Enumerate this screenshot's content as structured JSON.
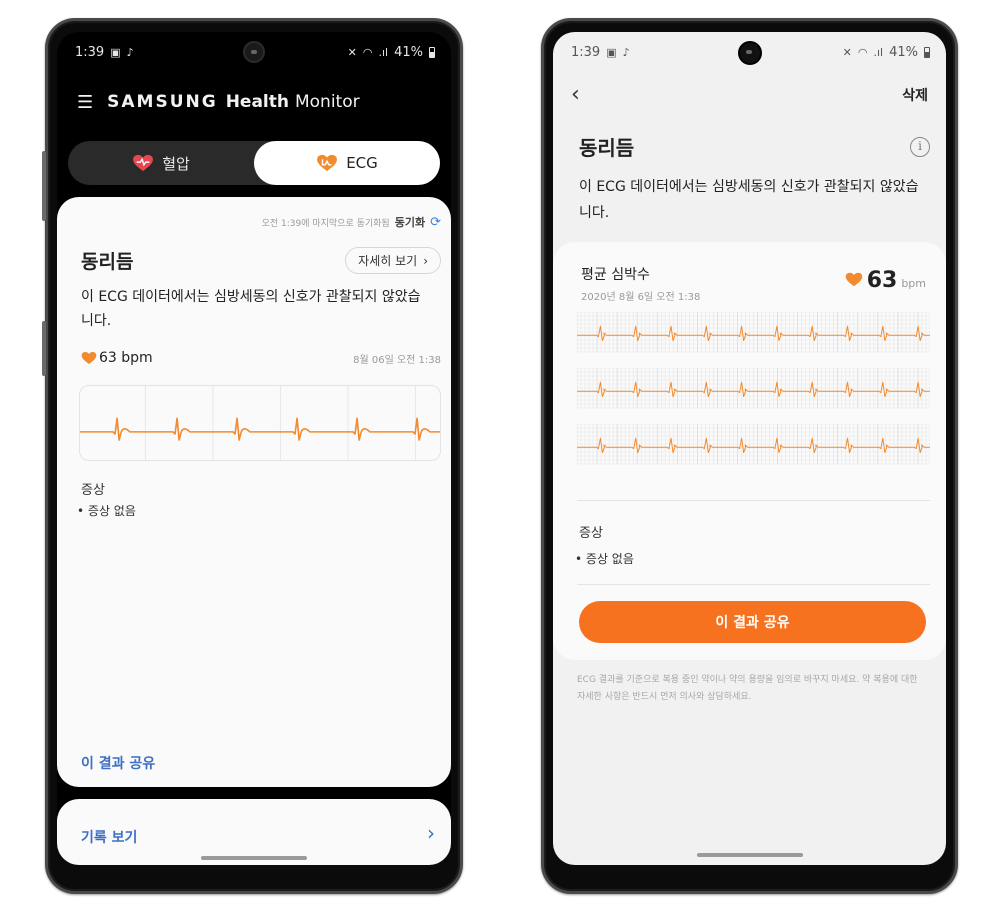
{
  "status_bar": {
    "time": "1:39",
    "battery": "41%"
  },
  "left_screen": {
    "app_title": {
      "brand": "SAMSUNG",
      "name1": "Health",
      "name2": "Monitor"
    },
    "tabs": [
      {
        "label": "혈압",
        "icon": "heart-blood-pressure-icon",
        "active": false,
        "color": "#e8474f"
      },
      {
        "label": "ECG",
        "icon": "heart-ecg-icon",
        "active": true,
        "color": "#f28a2e"
      }
    ],
    "sync": {
      "text": "오전 1:39에 마지막으로 동기화됨",
      "label": "동기화"
    },
    "result": {
      "title": "동리듬",
      "details_button": "자세히 보기",
      "description": "이 ECG 데이터에서는 심방세동의 신호가 관찰되지 않았습니다.",
      "bpm": "63 bpm",
      "date": "8월 06일 오전 1:38"
    },
    "symptoms": {
      "title": "증상",
      "items": [
        "증상 없음"
      ]
    },
    "share_link": "이 결과 공유",
    "history_link": "기록 보기"
  },
  "right_screen": {
    "delete_label": "삭제",
    "title": "동리듬",
    "description": "이 ECG 데이터에서는 심방세동의 신호가 관찰되지 않았습니다.",
    "avg_hr_label": "평균 심박수",
    "avg_hr_date": "2020년 8월 6일 오전 1:38",
    "avg_hr_value": "63",
    "avg_hr_unit": "bpm",
    "symptoms": {
      "title": "증상",
      "items": [
        "증상 없음"
      ]
    },
    "share_button": "이 결과 공유",
    "disclaimer": "ECG 결과를 기준으로 복용 중인 약이나 약의 용량을 임의로 바꾸지 마세요. 약 복용에 대한 자세한 사항은 반드시 먼저 의사와 상담하세요."
  },
  "colors": {
    "ecg_accent": "#f28a2e",
    "share_button": "#f7721e",
    "link_blue": "#3e6fc4"
  }
}
